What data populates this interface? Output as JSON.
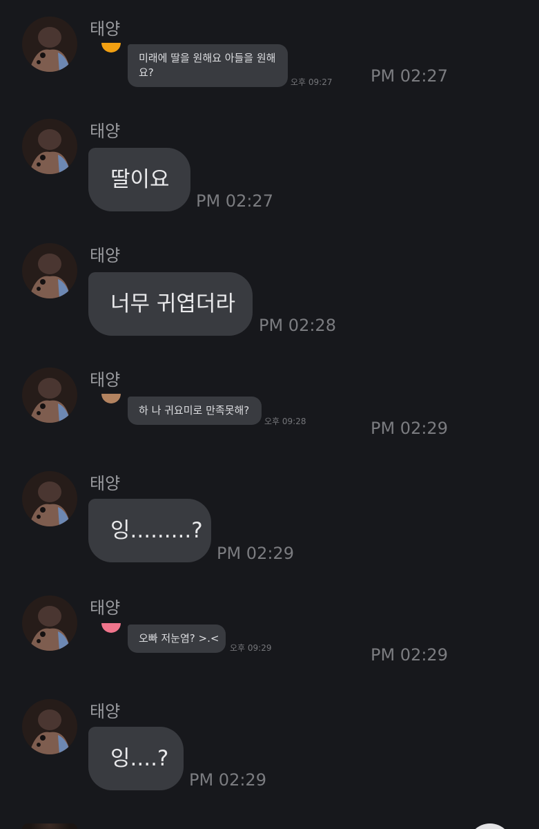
{
  "sender_name": "태양",
  "colors": {
    "background": "#17181c",
    "bubble": "#393b40",
    "mini_avatar_1": "#f2a012",
    "mini_avatar_2": "#b38360",
    "mini_avatar_3": "#f0758c"
  },
  "messages": [
    {
      "type": "embedded",
      "inner_text": "미래에 딸을 원해요 아들을 원해요?",
      "inner_time": "오후 09:27",
      "time": "PM 02:27"
    },
    {
      "type": "text",
      "text": "딸이요",
      "time": "PM 02:27"
    },
    {
      "type": "text",
      "text": "너무 귀엽더라",
      "time": "PM 02:28"
    },
    {
      "type": "embedded",
      "inner_text": "하 나 귀요미로 만족못해?",
      "inner_time": "오후 09:28",
      "time": "PM 02:29"
    },
    {
      "type": "text",
      "text": "잉.........?",
      "time": "PM 02:29"
    },
    {
      "type": "embedded",
      "inner_text": "오빠 저눈염? >.<",
      "inner_time": "오후 09:29",
      "time": "PM 02:29"
    },
    {
      "type": "text",
      "text": "잉....?",
      "time": "PM 02:29"
    }
  ]
}
